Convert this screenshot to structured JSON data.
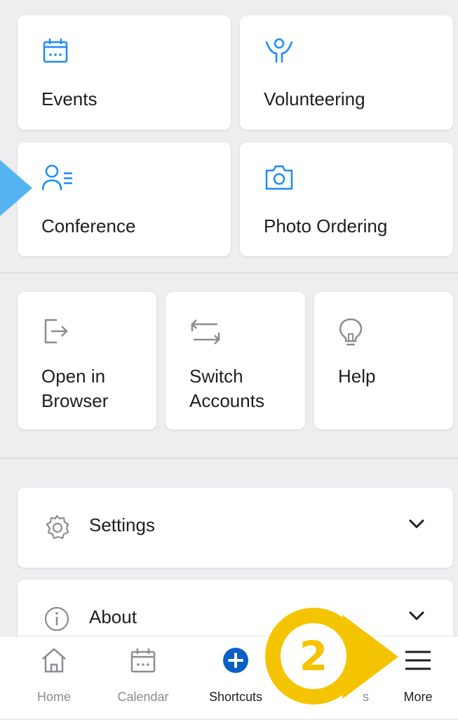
{
  "grid_top": [
    {
      "label": "Events",
      "icon": "calendar-icon"
    },
    {
      "label": "Volunteering",
      "icon": "volunteer-icon"
    },
    {
      "label": "Conference",
      "icon": "conference-icon"
    },
    {
      "label": "Photo Ordering",
      "icon": "camera-icon"
    }
  ],
  "grid_bottom": [
    {
      "label_line1": "Open in",
      "label_line2": "Browser",
      "icon": "open-in-browser-icon"
    },
    {
      "label_line1": "Switch",
      "label_line2": "Accounts",
      "icon": "switch-accounts-icon"
    },
    {
      "label_line1": "Help",
      "label_line2": "",
      "icon": "lightbulb-icon"
    }
  ],
  "accordions": [
    {
      "label": "Settings",
      "icon": "gear-icon"
    },
    {
      "label": "About",
      "icon": "info-icon"
    }
  ],
  "tabbar": {
    "items": [
      {
        "label": "Home",
        "icon": "home-icon",
        "active": false
      },
      {
        "label": "Calendar",
        "icon": "calendar-icon",
        "active": false
      },
      {
        "label": "Shortcuts",
        "icon": "plus-circle-icon",
        "active": true
      },
      {
        "label": "s",
        "icon": "hidden-tab-icon",
        "active": false
      },
      {
        "label": "More",
        "icon": "hamburger-menu-icon",
        "active": false
      }
    ]
  },
  "annotation": {
    "step_number": "2"
  },
  "colors": {
    "accent_blue": "#1877f2",
    "icon_blue": "#1a8cff",
    "pointer_blue": "#55b3f1",
    "badge_yellow": "#f5c400",
    "icon_gray": "#8a8d91"
  }
}
